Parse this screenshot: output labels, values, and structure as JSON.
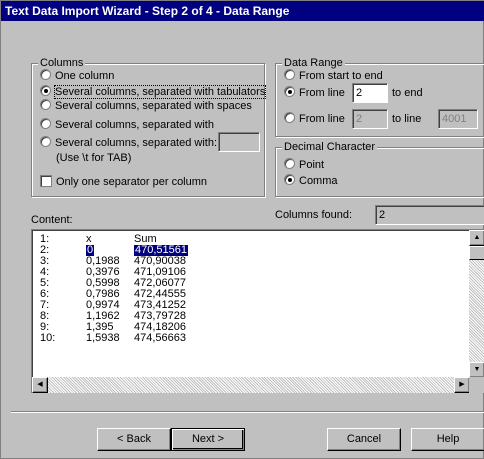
{
  "window": {
    "title": "Text Data Import Wizard - Step 2 of 4 - Data Range"
  },
  "columns": {
    "label": "Columns",
    "options": [
      {
        "label": "One column",
        "selected": false
      },
      {
        "label": "Several columns, separated with tabulators",
        "selected": true
      },
      {
        "label": "Several columns, separated with spaces",
        "selected": false
      },
      {
        "label": "Several columns, separated with",
        "selected": false
      },
      {
        "label": "Several columns, separated with:",
        "selected": false
      }
    ],
    "separator_value": "",
    "tab_hint": "(Use \\t for TAB)",
    "one_separator": {
      "label": "Only one separator per column",
      "checked": false
    }
  },
  "data_range": {
    "label": "Data Range",
    "options": [
      {
        "label": "From start to end",
        "selected": false
      },
      {
        "label": "From line",
        "selected": true,
        "value": "2",
        "suffix": "to end"
      },
      {
        "label": "From line",
        "selected": false,
        "value": "2",
        "suffix": "to line",
        "to_value": "4001"
      }
    ]
  },
  "decimal": {
    "label": "Decimal Character",
    "options": [
      {
        "label": "Point",
        "selected": false
      },
      {
        "label": "Comma",
        "selected": true
      }
    ]
  },
  "columns_found": {
    "label": "Columns found:",
    "value": "2"
  },
  "content": {
    "label": "Content:",
    "rows": [
      {
        "num": "1:",
        "x": "x",
        "sum": "Sum"
      },
      {
        "num": "2:",
        "x": "0",
        "sum": "470,51561"
      },
      {
        "num": "3:",
        "x": "0,1988",
        "sum": "470,90038"
      },
      {
        "num": "4:",
        "x": "0,3976",
        "sum": "471,09106"
      },
      {
        "num": "5:",
        "x": "0,5998",
        "sum": "472,06077"
      },
      {
        "num": "6:",
        "x": "0,7986",
        "sum": "472,44555"
      },
      {
        "num": "7:",
        "x": "0,9974",
        "sum": "473,41252"
      },
      {
        "num": "8:",
        "x": "1,1962",
        "sum": "473,79728"
      },
      {
        "num": "9:",
        "x": "1,395",
        "sum": "474,18206"
      },
      {
        "num": "10:",
        "x": "1,5938",
        "sum": "474,56663"
      }
    ]
  },
  "buttons": {
    "back": "< Back",
    "next": "Next >",
    "cancel": "Cancel",
    "help": "Help"
  },
  "icons": {
    "scroll_up": "arrow-up-icon",
    "scroll_down": "arrow-down-icon",
    "scroll_left": "arrow-left-icon",
    "scroll_right": "arrow-right-icon"
  },
  "colors": {
    "titlebar": "#000080",
    "face": "#c0c0c0",
    "selection": "#000080"
  }
}
